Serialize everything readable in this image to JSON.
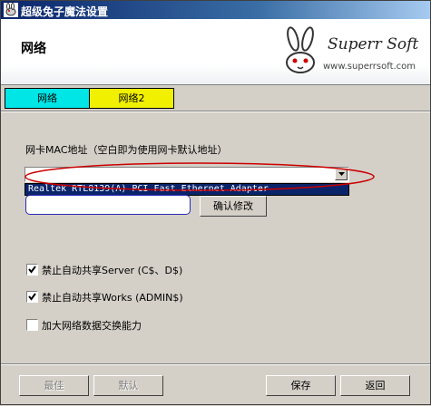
{
  "window": {
    "title": "超级兔子魔法设置"
  },
  "header": {
    "title": "网络",
    "logo_text": "Superr Soft",
    "logo_url": "www.superrsoft.com"
  },
  "tabs": [
    {
      "label": "网络",
      "color": "#00e5e5"
    },
    {
      "label": "网络2",
      "color": "#f0f000"
    }
  ],
  "mac": {
    "label": "网卡MAC地址（空白即为使用网卡默认地址）",
    "adapter_selected": "",
    "dropdown_item": "Realtek RTL8139(A) PCI Fast Ethernet Adapter",
    "mac_value": "",
    "confirm_label": "确认修改"
  },
  "options": [
    {
      "label": "禁止自动共享Server (C$、D$)",
      "checked": true
    },
    {
      "label": "禁止自动共享Works (ADMIN$)",
      "checked": true
    },
    {
      "label": "加大网络数据交换能力",
      "checked": false
    }
  ],
  "footer": {
    "best_label": "最佳",
    "default_label": "默认",
    "save_label": "保存",
    "back_label": "返回"
  },
  "highlight_color": "#cc0000"
}
